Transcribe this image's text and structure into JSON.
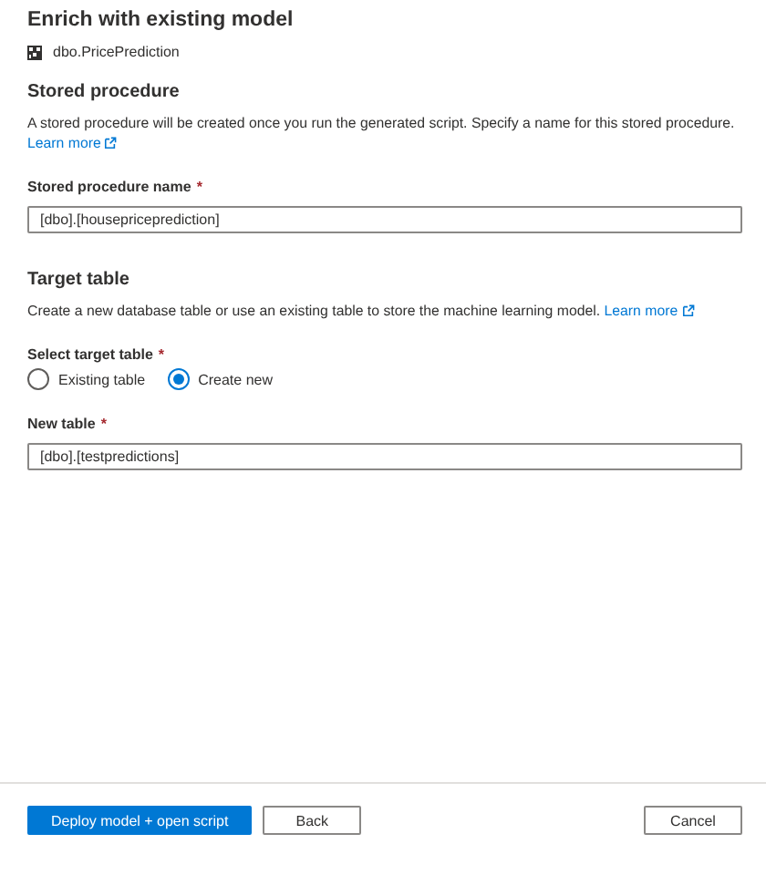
{
  "title": "Enrich with existing model",
  "model": {
    "name": "dbo.PricePrediction"
  },
  "sections": [
    {
      "heading": "Stored procedure",
      "description": "A stored procedure will be created once you run the generated script. Specify a name for this stored procedure.",
      "link": "Learn more",
      "fields": [
        {
          "kind": "text",
          "label": "Stored procedure name",
          "required_mark": "*",
          "value": "[dbo].[housepriceprediction]"
        }
      ]
    },
    {
      "heading": "Target table",
      "description": "Create a new database table or use an existing table to store the machine learning model.",
      "link": "Learn more",
      "fields": [
        {
          "kind": "radio",
          "label": "Select target table",
          "required_mark": "*",
          "options": [
            {
              "label": "Existing table",
              "selected": false
            },
            {
              "label": "Create new",
              "selected": true
            }
          ]
        },
        {
          "kind": "text",
          "label": "New table",
          "required_mark": "*",
          "value": "[dbo].[testpredictions]"
        }
      ]
    }
  ],
  "buttons": [
    {
      "label": "Deploy model + open script",
      "kind": "primary"
    },
    {
      "label": "Back",
      "kind": "secondary"
    },
    {
      "label": "Cancel",
      "kind": "secondary-right"
    }
  ]
}
